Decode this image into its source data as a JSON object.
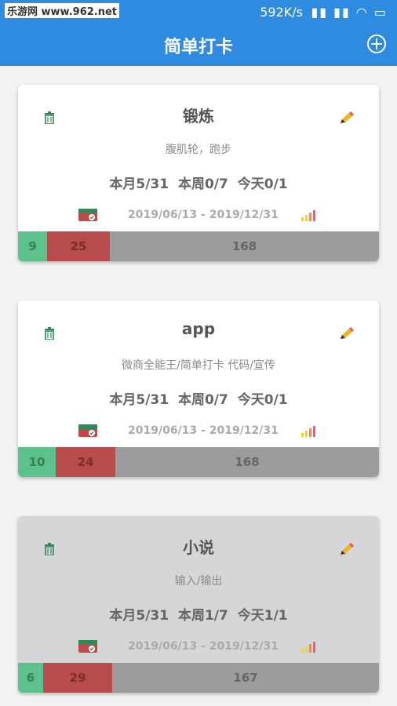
{
  "status": {
    "watermark": "乐游网 www.962.net",
    "speed": "592K/s"
  },
  "app": {
    "title": "简单打卡"
  },
  "cards": [
    {
      "title": "锻炼",
      "subtitle": "腹肌轮，跑步",
      "stats": "本月5/31  本周0/7  今天0/1",
      "dates": "2019/06/13 - 2019/12/31",
      "done": "9",
      "missed": "25",
      "remaining": "168",
      "done_frac": 0.0797,
      "missed_frac": 0.1739
    },
    {
      "title": "app",
      "subtitle": "微商全能王/简单打卡   代码/宣传",
      "stats": "本月5/31  本周0/7  今天0/1",
      "dates": "2019/06/13 - 2019/12/31",
      "done": "10",
      "missed": "24",
      "remaining": "168",
      "done_frac": 0.1043,
      "missed_frac": 0.1652
    },
    {
      "title": "小说",
      "subtitle": "输入/输出",
      "stats": "本月5/31  本周1/7  今天1/1",
      "dates": "2019/06/13 - 2019/12/31",
      "done": "6",
      "missed": "29",
      "remaining": "167",
      "done_frac": 0.0696,
      "missed_frac": 0.1913
    }
  ],
  "colors": {
    "appbar": "#2f8be0",
    "done": "#5bc28b",
    "missed": "#b84c4a",
    "remaining": "#9a9c9e"
  },
  "icons": [
    "trash-icon",
    "pencil-icon",
    "card-check-icon",
    "bar-chart-icon",
    "add-circle-icon"
  ]
}
